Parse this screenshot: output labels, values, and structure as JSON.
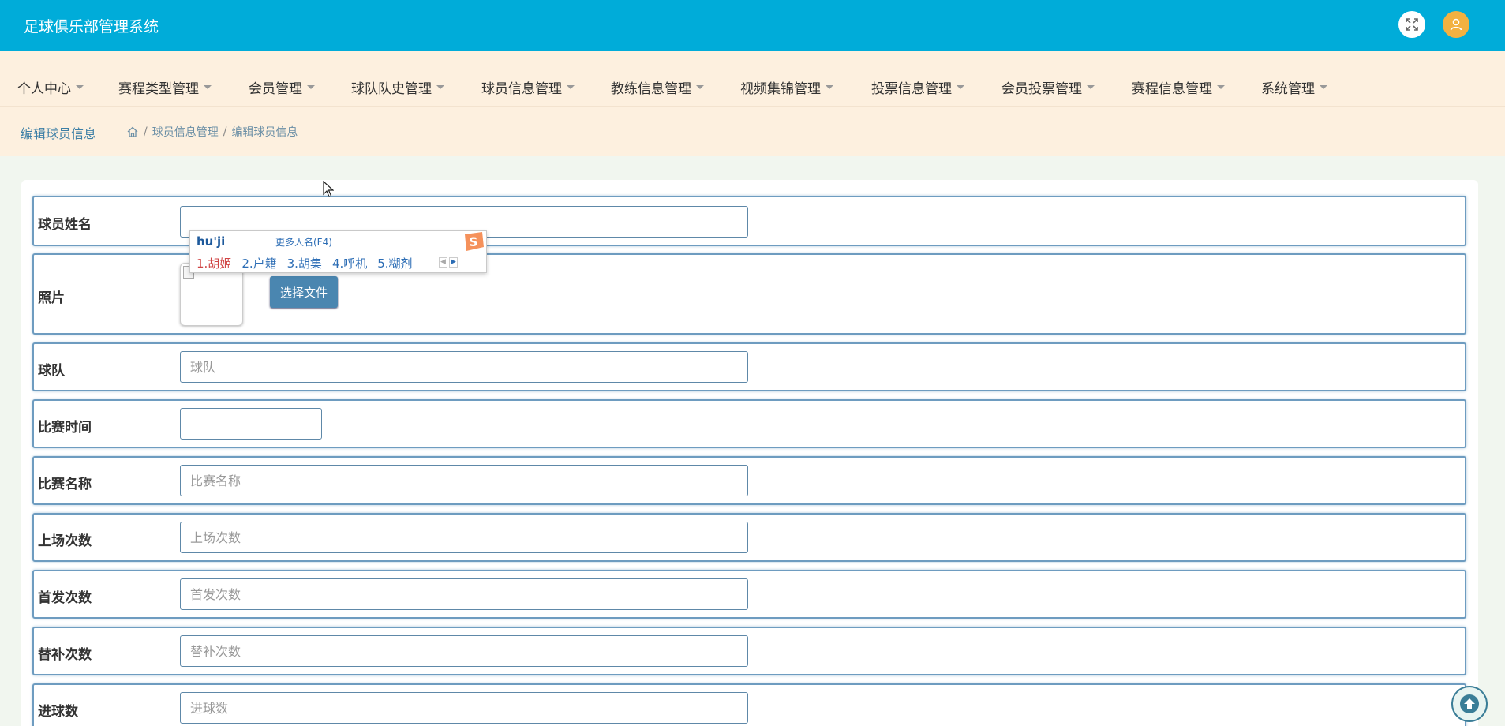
{
  "header": {
    "title": "足球俱乐部管理系统"
  },
  "nav": {
    "items": [
      {
        "label": "个人中心"
      },
      {
        "label": "赛程类型管理"
      },
      {
        "label": "会员管理"
      },
      {
        "label": "球队队史管理"
      },
      {
        "label": "球员信息管理"
      },
      {
        "label": "教练信息管理"
      },
      {
        "label": "视频集锦管理"
      },
      {
        "label": "投票信息管理"
      },
      {
        "label": "会员投票管理"
      },
      {
        "label": "赛程信息管理"
      },
      {
        "label": "系统管理"
      }
    ]
  },
  "breadcrumb": {
    "page_title": "编辑球员信息",
    "sep": "/",
    "crumb1": "球员信息管理",
    "crumb2": "编辑球员信息"
  },
  "form": {
    "name": {
      "label": "球员姓名",
      "value": ""
    },
    "photo": {
      "label": "照片",
      "button": "选择文件"
    },
    "team": {
      "label": "球队",
      "placeholder": "球队"
    },
    "match_time": {
      "label": "比赛时间",
      "value": ""
    },
    "match_name": {
      "label": "比赛名称",
      "placeholder": "比赛名称"
    },
    "appearances": {
      "label": "上场次数",
      "placeholder": "上场次数"
    },
    "starts": {
      "label": "首发次数",
      "placeholder": "首发次数"
    },
    "subs": {
      "label": "替补次数",
      "placeholder": "替补次数"
    },
    "goals": {
      "label": "进球数",
      "placeholder": "进球数"
    }
  },
  "ime": {
    "pinyin": "hu'ji",
    "more": "更多人名(F4)",
    "candidates": [
      "1.胡姬",
      "2.户籍",
      "3.胡集",
      "4.呼机",
      "5.糊剂"
    ]
  },
  "colors": {
    "header": "#00acd9",
    "nav_bg": "#fdf0df",
    "accent": "#4a86b0",
    "avatar": "#f2b141"
  },
  "icons": [
    "fullscreen-icon",
    "user-icon",
    "home-icon",
    "arrow-up-icon",
    "mouse-cursor-icon",
    "sogou-ime-logo"
  ]
}
